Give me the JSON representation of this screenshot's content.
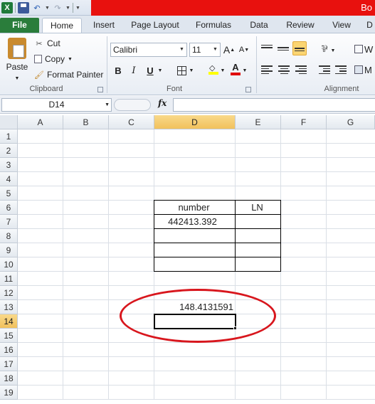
{
  "window": {
    "title_fragment": "Bo"
  },
  "tabs": [
    "File",
    "Home",
    "Insert",
    "Page Layout",
    "Formulas",
    "Data",
    "Review",
    "View",
    "D"
  ],
  "clipboard": {
    "paste": "Paste",
    "cut": "Cut",
    "copy": "Copy",
    "format_painter": "Format Painter",
    "group_label": "Clipboard"
  },
  "font": {
    "name": "Calibri",
    "size": "11",
    "group_label": "Font"
  },
  "alignment": {
    "group_label": "Alignment",
    "wrap_fragment": "W",
    "merge_fragment": "M"
  },
  "formula_bar": {
    "name_box": "D14",
    "fx": "fx",
    "formula": ""
  },
  "sheet": {
    "columns": [
      "A",
      "B",
      "C",
      "D",
      "E",
      "F",
      "G"
    ],
    "rows": [
      "1",
      "2",
      "3",
      "4",
      "5",
      "6",
      "7",
      "8",
      "9",
      "10",
      "11",
      "12",
      "13",
      "14",
      "15",
      "16",
      "17",
      "18",
      "19"
    ],
    "selected_cell": "D14",
    "cells": {
      "D6": "number",
      "E6": "LN",
      "D7": "442413.392",
      "D13": "148.4131591"
    }
  },
  "colors": {
    "title_bar": "#e8110e",
    "file_tab": "#2a7d3b",
    "annotation_ellipse": "#d8161d",
    "selected_header": "#f1c15c"
  }
}
